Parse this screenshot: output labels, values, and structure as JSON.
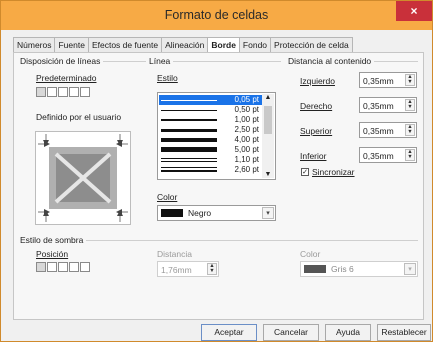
{
  "window": {
    "title": "Formato de celdas",
    "close_glyph": "×"
  },
  "tabs": [
    {
      "label": "Números",
      "active": false
    },
    {
      "label": "Fuente",
      "active": false
    },
    {
      "label": "Efectos de fuente",
      "active": false
    },
    {
      "label": "Alineación",
      "active": false
    },
    {
      "label": "Borde",
      "active": true
    },
    {
      "label": "Fondo",
      "active": false
    },
    {
      "label": "Protección de celda",
      "active": false
    }
  ],
  "line_arrangement": {
    "title": "Disposición de líneas",
    "default_label": "Predeterminado",
    "user_defined_label": "Definido por el usuario"
  },
  "line": {
    "title": "Línea",
    "style_label": "Estilo",
    "styles": [
      {
        "label": "0,05 pt",
        "selected": true
      },
      {
        "label": "0,50 pt",
        "selected": false
      },
      {
        "label": "1,00 pt",
        "selected": false
      },
      {
        "label": "2,50 pt",
        "selected": false
      },
      {
        "label": "4,00 pt",
        "selected": false
      },
      {
        "label": "5,00 pt",
        "selected": false
      },
      {
        "label": "1,10 pt",
        "selected": false
      },
      {
        "label": "2,60 pt",
        "selected": false
      }
    ],
    "color_label": "Color",
    "color_value": "Negro",
    "color_swatch": "#111111"
  },
  "padding": {
    "title": "Distancia al contenido",
    "fields": [
      {
        "label": "Izquierdo",
        "value": "0,35mm"
      },
      {
        "label": "Derecho",
        "value": "0,35mm"
      },
      {
        "label": "Superior",
        "value": "0,35mm"
      },
      {
        "label": "Inferior",
        "value": "0,35mm"
      }
    ],
    "sync_label": "Sincronizar",
    "sync_checked": true
  },
  "shadow": {
    "title": "Estilo de sombra",
    "position_label": "Posición",
    "distance_label": "Distancia",
    "distance_value": "1,76mm",
    "color_label": "Color",
    "color_value": "Gris 6",
    "color_swatch": "#555555"
  },
  "buttons": {
    "ok": "Aceptar",
    "cancel": "Cancelar",
    "help": "Ayuda",
    "reset": "Restablecer"
  }
}
